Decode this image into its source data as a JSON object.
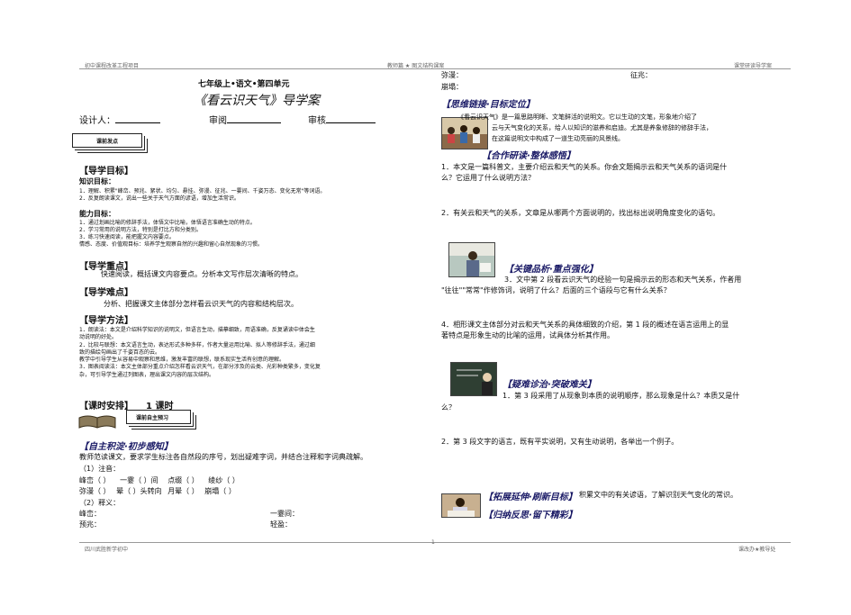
{
  "header": {
    "left": "初中课程改革工程项目",
    "center": "教师篇 ★ 图文结构课案",
    "right": "课堂研读导学案"
  },
  "footer": {
    "left": "四川武胜新学初中",
    "center": "1",
    "right": "课改办★教导处"
  },
  "left": {
    "grade": "七年级上•语文•第四单元",
    "title": "《看云识天气》导学案",
    "designer": "设计人：",
    "review1": "审阅",
    "review2": "审核",
    "tag1": "课前发点",
    "goals_title": "【导学目标】",
    "knowledge_title": "知识目标：",
    "knowledge": [
      "1．理解、积累\"峰峦、预兆、絮状、均匀、悬挂、弥漫、征兆、一霎间、千姿万态、变化无常\"等词语。",
      "2．反复朗读课文，说出一些关于天气方面的谚语，增加生活常识。"
    ],
    "ability_title": "能力目标：",
    "ability": [
      "1．通过划画比喻的修辞手法，体悟文中比喻，体悟语言准确生动的特点。",
      "2．学习常用的说明方法，特别是打比方和分类别。",
      "3．练习快速阅读，能把握文内容要点。"
    ],
    "emotion": "情感、态度、价值观目标：培养学生观察自然的兴趣和留心自然现象的习惯。",
    "key_title": "【导学重点】",
    "key": "快速阅读，概括课文内容要点。分析本文写作层次清晰的特点。",
    "diff_title": "【导学难点】",
    "diff": "分析、把握课文主体部分怎样看云识天气的内容和结构层次。",
    "method_title": "【导学方法】",
    "method": [
      "1．朗读法：本文是介绍科学知识的说明文，但语言生动，描摹细致，用语准确，反复诵读中体会生",
      "动说明的好处。",
      "2．比较与联想：本文语言生动，表达形式多种多样，作者大量运用比喻、拟人等修辞手法，通过细",
      "致的描绘勾画出了千姿百态的云。",
      "教学中引导学生从容易中观察和思维，激发丰富的联想，联系现实生活有创意的理解。",
      "3．图表阅读法：本文主体部分重点介绍怎样看云识天气，在部分涉及的云类、光彩种类繁多，变化复",
      "杂，可引导学生通过列图表，理出课文内容的层次结构。"
    ],
    "schedule_title": "【课时安排】",
    "schedule": "1 课时",
    "tag2": "课前自主预习",
    "self_title": "【自主积淀·初步感知】",
    "self_text": "教师范读课文，要求学生标注各自然段的序号，划出疑难字词，并结合注释和字词典疏解。",
    "zhuyin_label": "（1）注音：",
    "zhuyin_row1": [
      "峰峦（     ）",
      "一霎（     ）间",
      "点缀（     ）",
      "绫纱（     ）"
    ],
    "zhuyin_row2": [
      "弥漫（     ）",
      "晕（     ）",
      "头转向",
      "月晕（     ）",
      "崩塌（     ）"
    ],
    "shiyi_label": "（2）释义：",
    "shiyi_row1": [
      "峰峦：",
      "一霎间："
    ],
    "shiyi_row2": [
      "预兆：",
      "轻盈："
    ]
  },
  "right": {
    "top_rows": [
      [
        "弥漫：",
        "征兆："
      ],
      [
        "崩塌：",
        ""
      ]
    ],
    "s1_title": "【思维链接·目标定位】",
    "s1_text": [
      "《看云识天气》是一篇思路明晰、文笔鲜活的说明文。它以生动的文笔，形象地介绍了",
      "云与天气变化的关系，给人以知识的滋养和启迪。尤其是养象修辞的修辞手法，",
      "在这篇说明文中构成了一道生动亮丽的风景线。"
    ],
    "s2_title": "【合作研读·整体感悟】",
    "q1": [
      "1．本文是一篇科普文，主要介绍云和天气的关系。你会文题揭示云和天气关系的语词是什",
      "么？它运用了什么说明方法？"
    ],
    "q2": "2．有关云和天气的关系，文章是从哪两个方面说明的，找出标出说明角度变化的语句。",
    "s3_title": "【关键品析·重点强化】",
    "q3": [
      "3．文中第 2 段看云识天气的经验一句是揭示云的形态和天气关系，作者用",
      "\"往往\"\"常常\"作修饰词，说明了什么？后面的三个语段与它有什么关系？"
    ],
    "q4": [
      "4．相形课文主体部分对云和天气关系的具体细致的介绍，第 1 段的概述在语言运用上的显",
      "著特点是形象生动的比喻的运用，试具体分析其作用。"
    ],
    "s4_title": "【疑难诊治·突破难关】",
    "q5": [
      "1．第 3 段采用了从现象到本质的说明顺序，那么现象是什么？本质又是什",
      "么？"
    ],
    "q6": "2．第 3 段文字的语言，既有平实说明，又有生动说明，各举出一个例子。",
    "s5_title": "【拓展延伸·刷新目标】",
    "s5_text": "积累文中的有关谚语，了解识别天气变化的常识。",
    "s6_title": "【归纳反思·留下精彩】"
  }
}
